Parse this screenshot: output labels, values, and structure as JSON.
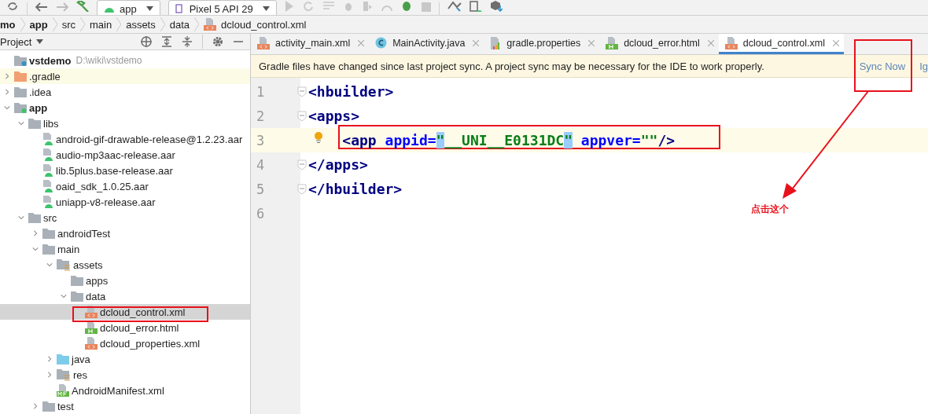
{
  "toolbar": {
    "run_config": "app",
    "device": "Pixel 5 API 29"
  },
  "breadcrumb": [
    {
      "label": "mo",
      "bold": true,
      "kind": "folder"
    },
    {
      "label": "app",
      "bold": true,
      "kind": "folder"
    },
    {
      "label": "src",
      "bold": false,
      "kind": "folder"
    },
    {
      "label": "main",
      "bold": false,
      "kind": "folder"
    },
    {
      "label": "assets",
      "bold": false,
      "kind": "folder"
    },
    {
      "label": "data",
      "bold": false,
      "kind": "folder"
    },
    {
      "label": "dcloud_control.xml",
      "bold": false,
      "kind": "xml"
    }
  ],
  "project_panel": {
    "title": "Project",
    "tree": [
      {
        "label": "vstdemo",
        "path": "D:\\wiki\\vstdemo",
        "kind": "project",
        "bold": true,
        "selected": false,
        "ignored": false,
        "children": [
          {
            "label": ".gradle",
            "kind": "gradle-folder",
            "expanded": false,
            "bold": false,
            "selected": false,
            "ignored": true
          },
          {
            "label": ".idea",
            "kind": "folder",
            "expanded": false,
            "bold": false,
            "selected": false,
            "ignored": false
          },
          {
            "label": "app",
            "kind": "module",
            "expanded": true,
            "bold": true,
            "selected": false,
            "ignored": false,
            "children": [
              {
                "label": "libs",
                "kind": "folder",
                "expanded": true,
                "bold": false,
                "selected": false,
                "ignored": false,
                "children": [
                  {
                    "label": "android-gif-drawable-release@1.2.23.aar",
                    "kind": "aar",
                    "bold": false,
                    "selected": false,
                    "ignored": false
                  },
                  {
                    "label": "audio-mp3aac-release.aar",
                    "kind": "aar",
                    "bold": false,
                    "selected": false,
                    "ignored": false
                  },
                  {
                    "label": "lib.5plus.base-release.aar",
                    "kind": "aar",
                    "bold": false,
                    "selected": false,
                    "ignored": false
                  },
                  {
                    "label": "oaid_sdk_1.0.25.aar",
                    "kind": "aar",
                    "bold": false,
                    "selected": false,
                    "ignored": false
                  },
                  {
                    "label": "uniapp-v8-release.aar",
                    "kind": "aar",
                    "bold": false,
                    "selected": false,
                    "ignored": false
                  }
                ]
              },
              {
                "label": "src",
                "kind": "folder",
                "expanded": true,
                "bold": false,
                "selected": false,
                "ignored": false,
                "children": [
                  {
                    "label": "androidTest",
                    "kind": "folder",
                    "expanded": false,
                    "bold": false,
                    "selected": false,
                    "ignored": false
                  },
                  {
                    "label": "main",
                    "kind": "folder",
                    "expanded": true,
                    "bold": false,
                    "selected": false,
                    "ignored": false,
                    "children": [
                      {
                        "label": "assets",
                        "kind": "res-folder",
                        "expanded": true,
                        "bold": false,
                        "selected": false,
                        "ignored": false,
                        "children": [
                          {
                            "label": "apps",
                            "kind": "folder",
                            "bold": false,
                            "selected": false,
                            "ignored": false
                          },
                          {
                            "label": "data",
                            "kind": "folder",
                            "expanded": true,
                            "bold": false,
                            "selected": false,
                            "ignored": false,
                            "children": [
                              {
                                "label": "dcloud_control.xml",
                                "kind": "xml",
                                "bold": false,
                                "selected": true,
                                "ignored": false
                              },
                              {
                                "label": "dcloud_error.html",
                                "kind": "html",
                                "bold": false,
                                "selected": false,
                                "ignored": false
                              },
                              {
                                "label": "dcloud_properties.xml",
                                "kind": "xml",
                                "bold": false,
                                "selected": false,
                                "ignored": false
                              }
                            ]
                          }
                        ]
                      },
                      {
                        "label": "java",
                        "kind": "java-folder",
                        "expanded": false,
                        "bold": false,
                        "selected": false,
                        "ignored": false
                      },
                      {
                        "label": "res",
                        "kind": "res-folder",
                        "expanded": false,
                        "bold": false,
                        "selected": false,
                        "ignored": false
                      },
                      {
                        "label": "AndroidManifest.xml",
                        "kind": "manifest",
                        "bold": false,
                        "selected": false,
                        "ignored": false
                      }
                    ]
                  },
                  {
                    "label": "test",
                    "kind": "folder",
                    "expanded": false,
                    "bold": false,
                    "selected": false,
                    "ignored": false
                  }
                ]
              }
            ]
          }
        ]
      }
    ]
  },
  "editor_tabs": [
    {
      "label": "activity_main.xml",
      "kind": "xml",
      "selected": false
    },
    {
      "label": "MainActivity.java",
      "kind": "java",
      "selected": false
    },
    {
      "label": "gradle.properties",
      "kind": "gradle",
      "selected": false
    },
    {
      "label": "dcloud_error.html",
      "kind": "html",
      "selected": false
    },
    {
      "label": "dcloud_control.xml",
      "kind": "xml",
      "selected": true
    }
  ],
  "banner": {
    "message": "Gradle files have changed since last project sync. A project sync may be necessary for the IDE to work properly.",
    "actions": [
      "Sync Now",
      "Ig"
    ]
  },
  "code_lines": [
    {
      "number": "1",
      "current": false,
      "fold": true,
      "bulb": false,
      "tokens": [
        {
          "text": "<hbuilder>",
          "kind": "tag",
          "highlight": false
        }
      ]
    },
    {
      "number": "2",
      "current": false,
      "fold": true,
      "bulb": false,
      "tokens": [
        {
          "text": "<apps>",
          "kind": "tag",
          "highlight": false
        }
      ]
    },
    {
      "number": "3",
      "current": true,
      "fold": false,
      "bulb": true,
      "tokens": [
        {
          "text": "    <app ",
          "kind": "tag",
          "highlight": false
        },
        {
          "text": "appid=",
          "kind": "attr",
          "highlight": false
        },
        {
          "text": "\"",
          "kind": "value",
          "highlight": true
        },
        {
          "text": "__UNI__E0131DC",
          "kind": "value",
          "highlight": false
        },
        {
          "text": "\"",
          "kind": "value",
          "highlight": true
        },
        {
          "text": " appver=",
          "kind": "attr",
          "highlight": false
        },
        {
          "text": "\"\"",
          "kind": "value",
          "highlight": false
        },
        {
          "text": "/>",
          "kind": "tag",
          "highlight": false
        }
      ]
    },
    {
      "number": "4",
      "current": false,
      "fold": true,
      "bulb": false,
      "tokens": [
        {
          "text": "</apps>",
          "kind": "tag",
          "highlight": false
        }
      ]
    },
    {
      "number": "5",
      "current": false,
      "fold": true,
      "bulb": false,
      "tokens": [
        {
          "text": "</hbuilder>",
          "kind": "tag",
          "highlight": false
        }
      ]
    },
    {
      "number": "6",
      "current": false,
      "fold": false,
      "bulb": false
    }
  ],
  "annotation": {
    "label": "点击这个"
  }
}
